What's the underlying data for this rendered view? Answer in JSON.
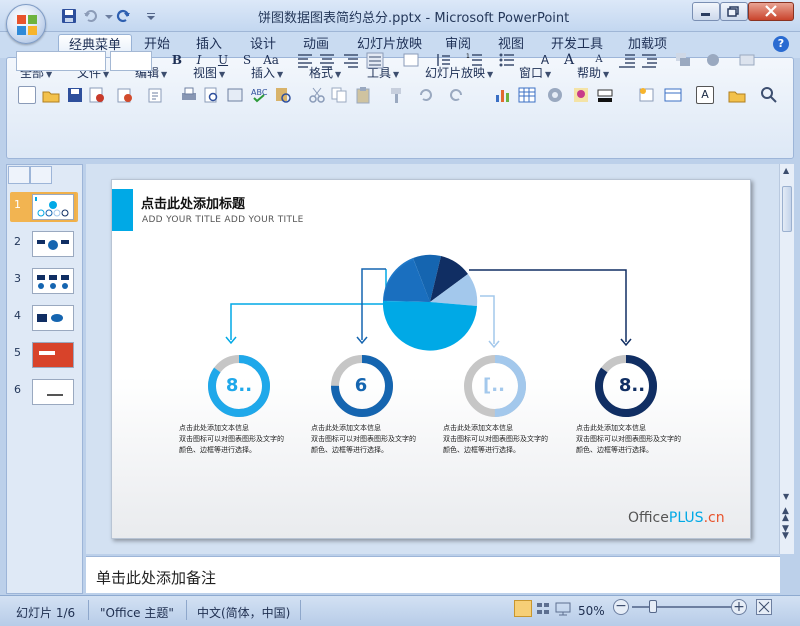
{
  "window": {
    "title": "饼图数据图表简约总分.pptx - Microsoft PowerPoint"
  },
  "ribbon_tabs": [
    "经典菜单",
    "开始",
    "插入",
    "设计",
    "动画",
    "幻灯片放映",
    "审阅",
    "视图",
    "开发工具",
    "加载项"
  ],
  "classic_menu": [
    {
      "label": "全部"
    },
    {
      "label": "文件"
    },
    {
      "label": "编辑"
    },
    {
      "label": "视图"
    },
    {
      "label": "插入"
    },
    {
      "label": "格式"
    },
    {
      "label": "工具"
    },
    {
      "label": "幻灯片放映"
    },
    {
      "label": "窗口"
    },
    {
      "label": "帮助"
    }
  ],
  "format_buttons": [
    "B",
    "I",
    "U",
    "S",
    "Aa"
  ],
  "thumbnails": [
    "1",
    "2",
    "3",
    "4",
    "5",
    "6"
  ],
  "slide": {
    "title": "点击此处添加标题",
    "subtitle": "ADD YOUR TITLE ADD YOUR TITLE",
    "rings": [
      {
        "value": "8..",
        "color": "#1fa8ea",
        "fraction": 0.85,
        "caption": [
          "点击此处添加文本信息",
          "双击图标可以对图表图形及文字的",
          "颜色、边框等进行选择。"
        ]
      },
      {
        "value": "6",
        "color": "#1565b0",
        "fraction": 0.75,
        "caption": [
          "点击此处添加文本信息",
          "双击图标可以对图表图形及文字的",
          "颜色、边框等进行选择。"
        ]
      },
      {
        "value": "[..",
        "color": "#a3c8ec",
        "fraction": 0.5,
        "caption": [
          "点击此处添加文本信息",
          "双击图标可以对图表图形及文字的",
          "颜色、边框等进行选择。"
        ]
      },
      {
        "value": "8..",
        "color": "#102e63",
        "fraction": 0.85,
        "caption": [
          "点击此处添加文本信息",
          "双击图标可以对图表图形及文字的",
          "颜色、边框等进行选择。"
        ]
      }
    ],
    "brand": {
      "prefix": "Office",
      "mid": "PLUS",
      "suffix": ".cn"
    }
  },
  "notes": {
    "placeholder": "单击此处添加备注"
  },
  "status": {
    "slide_indicator": "幻灯片 1/6",
    "theme": "\"Office 主题\"",
    "language": "中文(简体，中国)",
    "zoom": "50%"
  },
  "colors": {
    "accent": "#00a9e6",
    "dark_blue": "#102e63",
    "mid_blue": "#1565b0",
    "light_blue": "#a3c8ec",
    "ring_track": "#c6c6c6"
  }
}
